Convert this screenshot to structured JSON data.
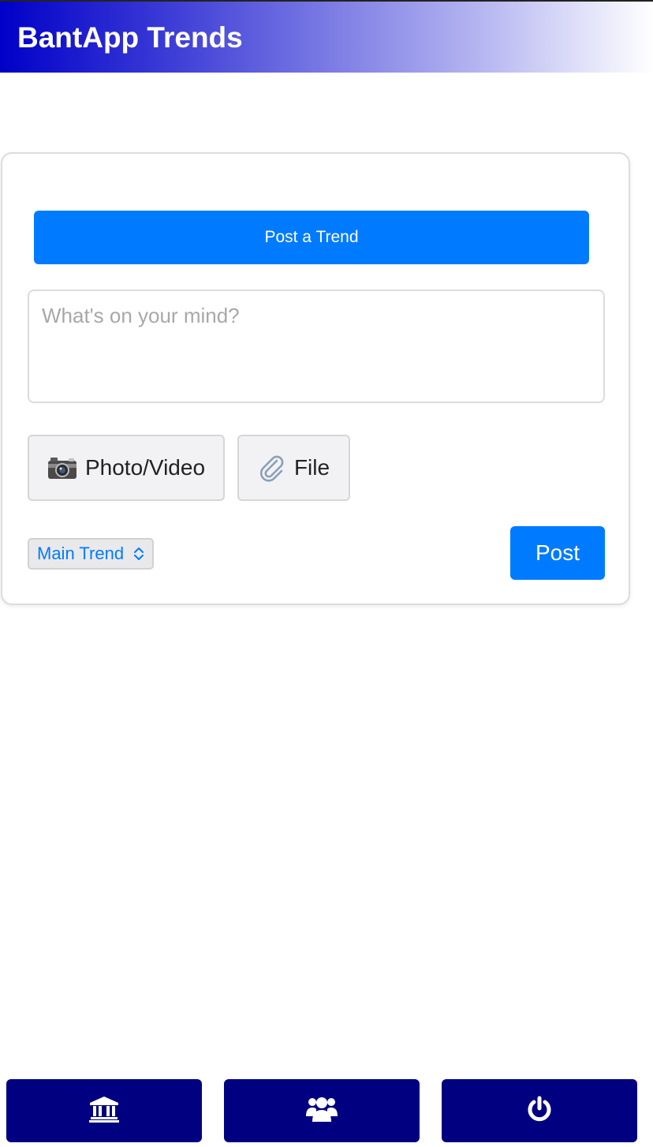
{
  "header": {
    "title": "BantApp Trends",
    "gradient_start": "#0000c8",
    "gradient_end": "#ffffff"
  },
  "composer": {
    "post_trend_label": "Post a Trend",
    "textarea_placeholder": "What's on your mind?",
    "textarea_value": "",
    "photo_video_label": "Photo/Video",
    "photo_video_icon": "camera-icon",
    "file_label": "File",
    "file_icon": "paperclip-icon",
    "trend_select_value": "Main Trend",
    "post_label": "Post",
    "accent_color": "#007bff"
  },
  "bottom_nav": {
    "color": "#000080",
    "items": [
      {
        "icon": "bank-icon"
      },
      {
        "icon": "users-icon"
      },
      {
        "icon": "power-icon"
      }
    ]
  }
}
